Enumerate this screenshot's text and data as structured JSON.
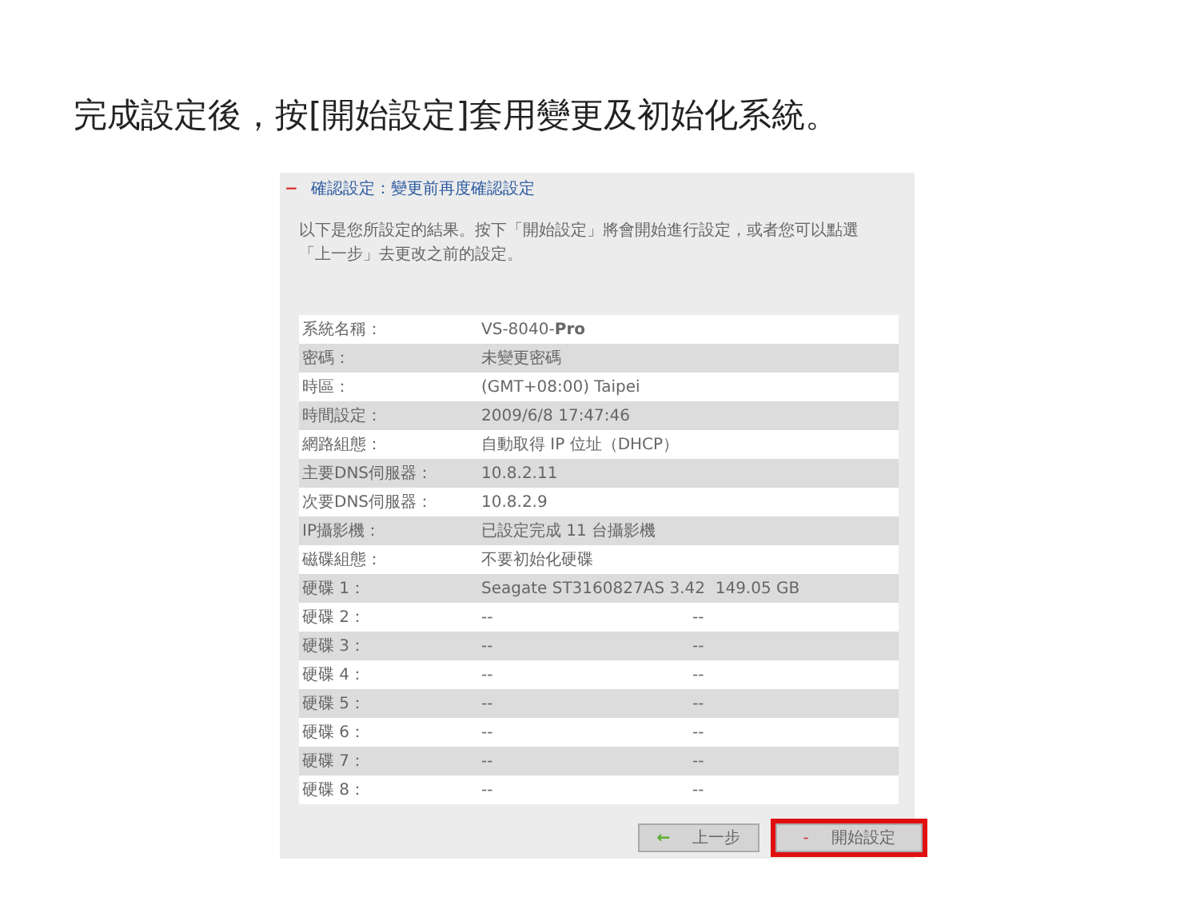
{
  "slide_title": "完成設定後，按[開始設定]套用變更及初始化系統。",
  "panel": {
    "marker": "−",
    "heading": "確認設定：變更前再度確認設定",
    "intro": "以下是您所設定的結果。按下「開始設定」將會開始進行設定，或者您可以點選「上一步」去更改之前的設定。",
    "rows": [
      {
        "label": "系統名稱：",
        "values": [
          "VS-8040-**Pro**"
        ]
      },
      {
        "label": "密碼：",
        "values": [
          "未變更密碼"
        ]
      },
      {
        "label": "時區：",
        "values": [
          "(GMT+08:00) Taipei"
        ]
      },
      {
        "label": "時間設定：",
        "values": [
          "2009/6/8 17:47:46"
        ]
      },
      {
        "label": "網路組態：",
        "values": [
          "自動取得 IP 位址（DHCP）"
        ]
      },
      {
        "label": "主要DNS伺服器：",
        "values": [
          "10.8.2.11"
        ]
      },
      {
        "label": "次要DNS伺服器：",
        "values": [
          "10.8.2.9"
        ]
      },
      {
        "label": "IP攝影機：",
        "values": [
          "已設定完成 11 台攝影機"
        ]
      },
      {
        "label": "磁碟組態：",
        "values": [
          "不要初始化硬碟"
        ]
      },
      {
        "label": "硬碟 1：",
        "values": [
          "Seagate ST3160827AS 3.42  149.05 GB"
        ]
      },
      {
        "label": "硬碟 2：",
        "values": [
          "--",
          "--"
        ]
      },
      {
        "label": "硬碟 3：",
        "values": [
          "--",
          "--"
        ]
      },
      {
        "label": "硬碟 4：",
        "values": [
          "--",
          "--"
        ]
      },
      {
        "label": "硬碟 5：",
        "values": [
          "--",
          "--"
        ]
      },
      {
        "label": "硬碟 6：",
        "values": [
          "--",
          "--"
        ]
      },
      {
        "label": "硬碟 7：",
        "values": [
          "--",
          "--"
        ]
      },
      {
        "label": "硬碟 8：",
        "values": [
          "--",
          "--"
        ]
      }
    ],
    "buttons": [
      {
        "kind": "back",
        "icon": "←",
        "label": "上一步",
        "highlighted": false
      },
      {
        "kind": "start",
        "icon": "-",
        "label": "開始設定",
        "highlighted": true
      }
    ]
  }
}
